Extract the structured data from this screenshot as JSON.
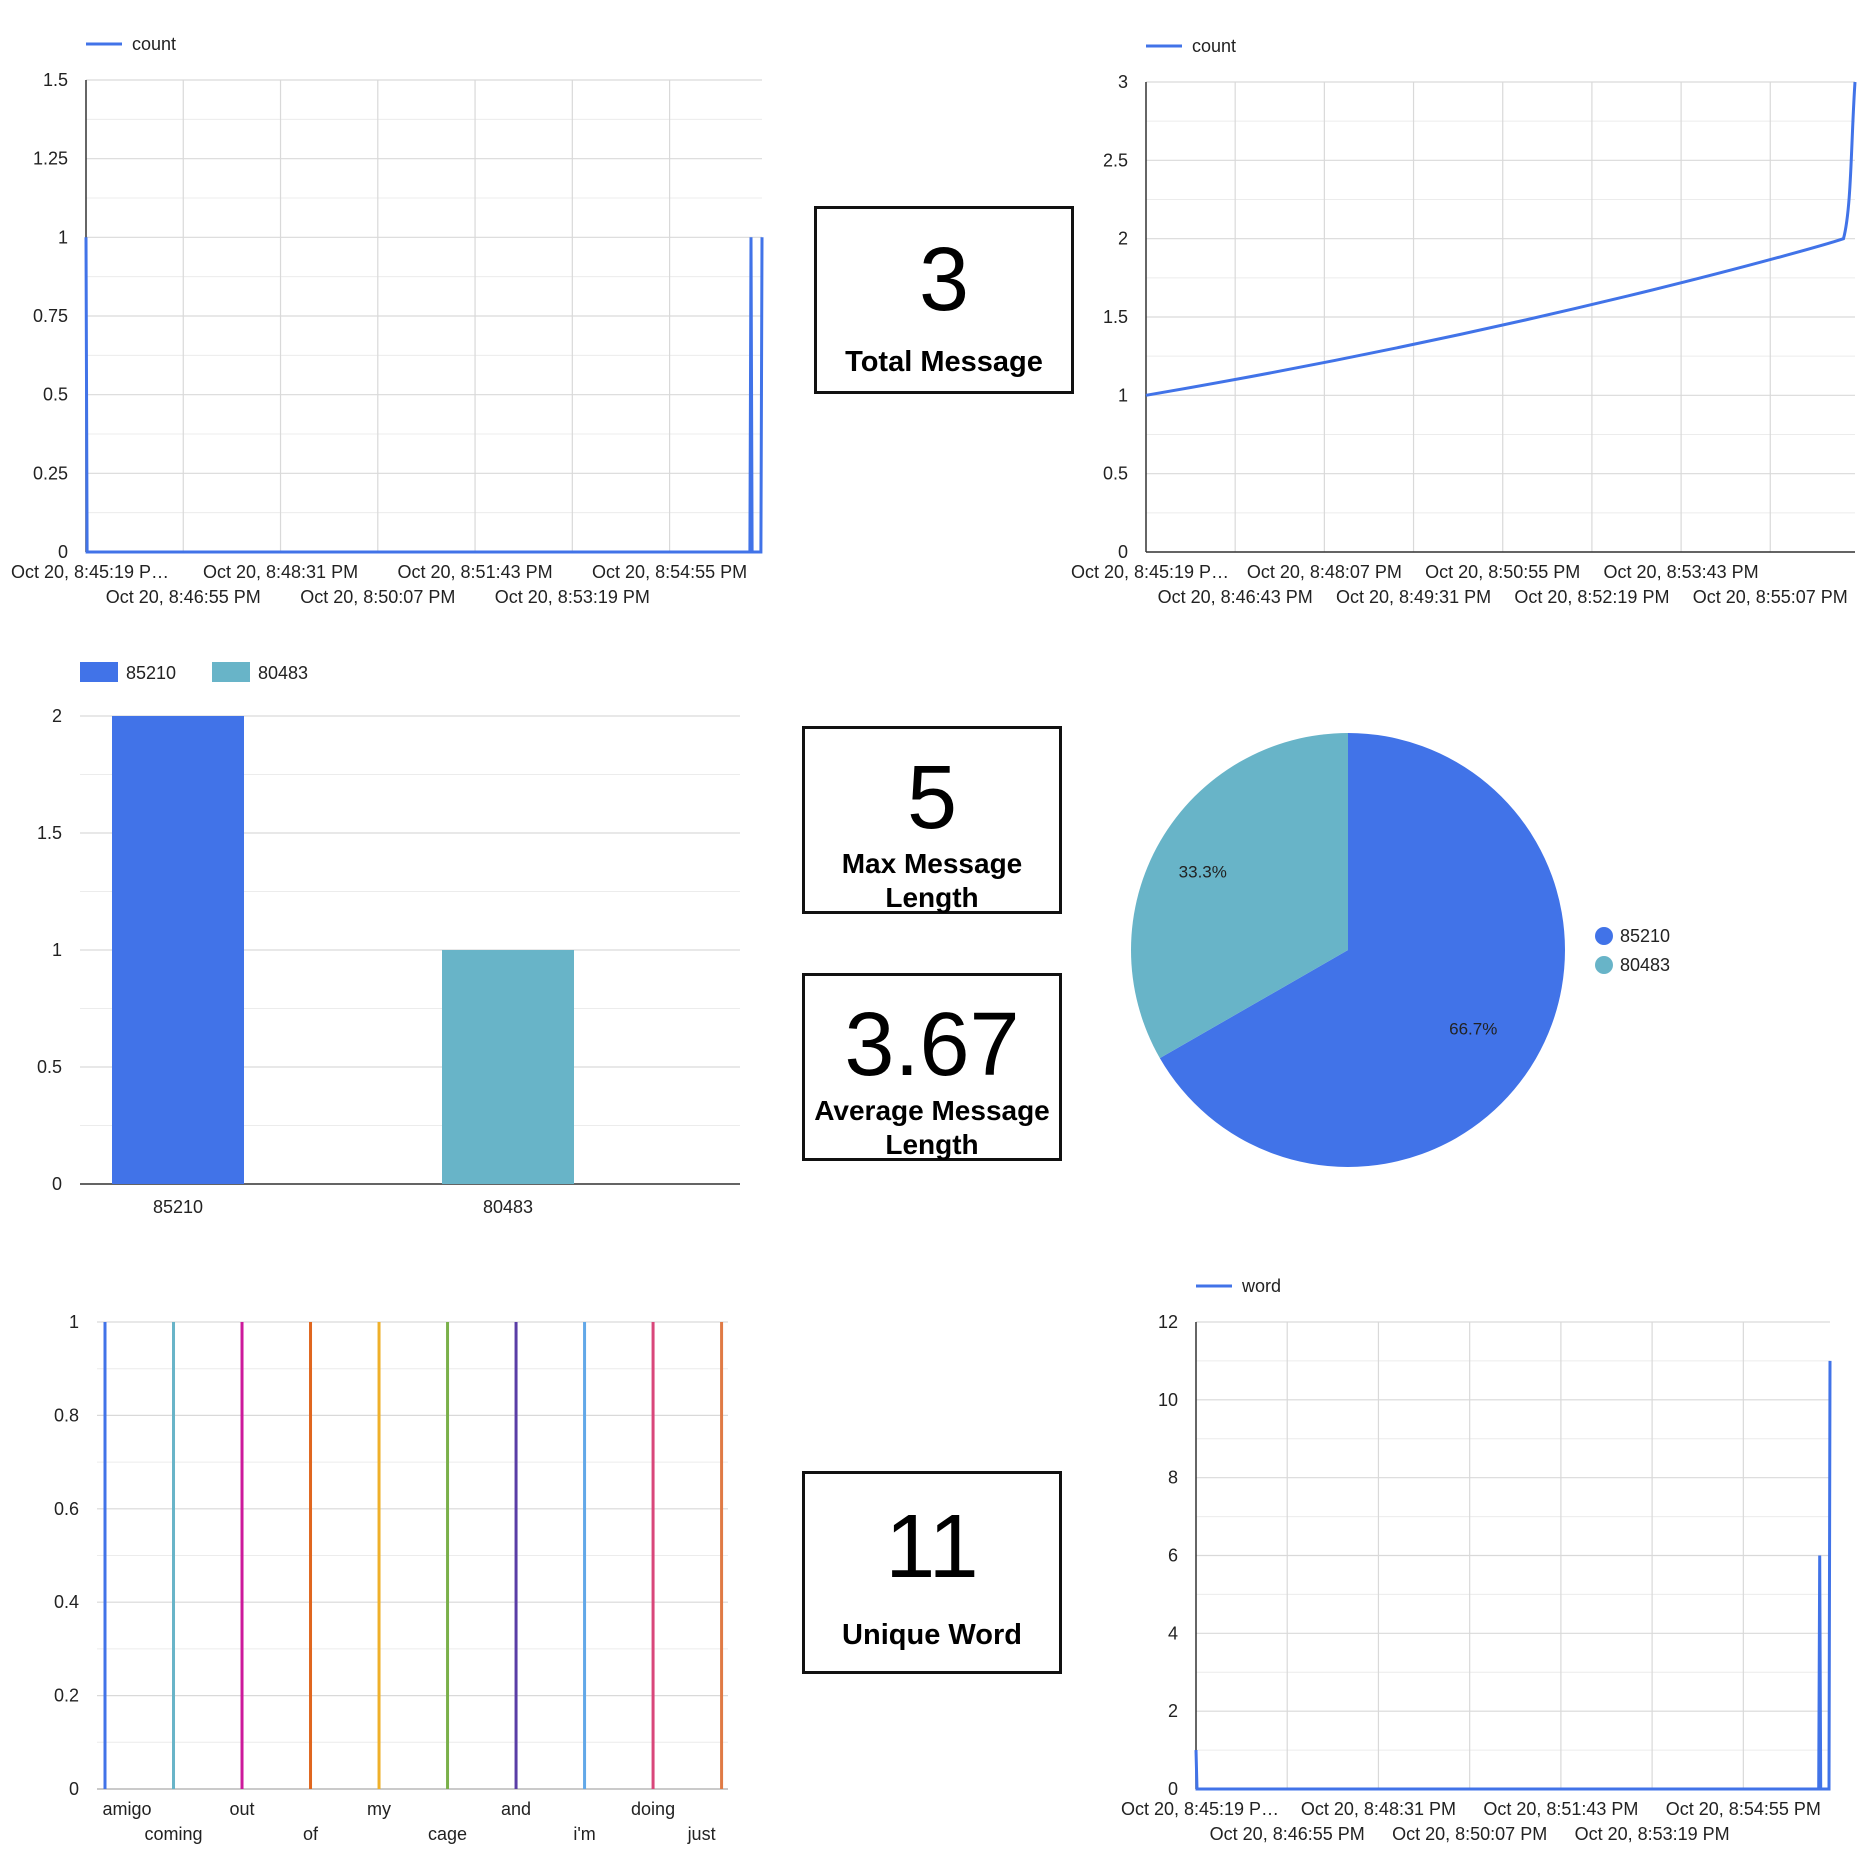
{
  "colors": {
    "blue": "#4173e8",
    "teal": "#68b4c8"
  },
  "charts": [
    {
      "id": "count_timeline",
      "type": "line",
      "legend": [
        "count"
      ],
      "x_ticks_top": [
        "Oct 20, 8:45:19 P…",
        "Oct 20, 8:48:31 PM",
        "Oct 20, 8:51:43 PM",
        "Oct 20, 8:54:55 PM"
      ],
      "x_ticks_bottom": [
        "Oct 20, 8:46:55 PM",
        "Oct 20, 8:50:07 PM",
        "Oct 20, 8:53:19 PM"
      ],
      "y_ticks": [
        "0",
        "0.25",
        "0.5",
        "0.75",
        "1",
        "1.25",
        "1.5"
      ],
      "ylim": [
        0,
        1.5
      ],
      "grid": true,
      "legend_position": "top-left",
      "series": [
        {
          "name": "count",
          "points": [
            [
              "8:45:19 PM",
              1
            ],
            [
              "8:45:20 PM",
              0
            ],
            [
              "8:55:24 PM",
              0
            ],
            [
              "8:55:25 PM",
              1
            ],
            [
              "8:55:26 PM",
              0
            ],
            [
              "8:55:34 PM",
              0
            ],
            [
              "8:55:35 PM",
              1
            ]
          ]
        }
      ]
    },
    {
      "id": "cumulative_count",
      "type": "line",
      "legend": [
        "count"
      ],
      "x_ticks_top": [
        "Oct 20, 8:45:19 P…",
        "Oct 20, 8:48:07 PM",
        "Oct 20, 8:50:55 PM",
        "Oct 20, 8:53:43 PM"
      ],
      "x_ticks_bottom": [
        "Oct 20, 8:46:43 PM",
        "Oct 20, 8:49:31 PM",
        "Oct 20, 8:52:19 PM",
        "Oct 20, 8:55:07 PM"
      ],
      "y_ticks": [
        "0",
        "0.5",
        "1",
        "1.5",
        "2",
        "2.5",
        "3"
      ],
      "ylim": [
        0,
        3
      ],
      "grid": true,
      "legend_position": "top-left",
      "series": [
        {
          "name": "count",
          "points": [
            [
              "8:45:19 PM",
              1
            ],
            [
              "8:55:25 PM",
              2
            ],
            [
              "8:55:35 PM",
              3
            ]
          ]
        }
      ]
    },
    {
      "id": "messages_by_user_bar",
      "type": "bar",
      "legend": [
        "85210",
        "80483"
      ],
      "categories": [
        "85210",
        "80483"
      ],
      "values": [
        2,
        1
      ],
      "y_ticks": [
        "0",
        "0.5",
        "1",
        "1.5",
        "2"
      ],
      "ylim": [
        0,
        2
      ],
      "grid": true,
      "legend_position": "top-left"
    },
    {
      "id": "messages_by_user_pie",
      "type": "pie",
      "legend": [
        "85210",
        "80483"
      ],
      "values": [
        66.7,
        33.3
      ],
      "labels": [
        "66.7%",
        "33.3%"
      ],
      "legend_position": "right"
    },
    {
      "id": "words_bar",
      "type": "bar",
      "categories": [
        "amigo",
        "coming",
        "out",
        "of",
        "my",
        "cage",
        "and",
        "i'm",
        "doing",
        "just"
      ],
      "values": [
        1,
        1,
        1,
        1,
        1,
        1,
        1,
        1,
        1,
        1
      ],
      "bar_colors": [
        "#4173e8",
        "#68b4c8",
        "#cc1a9b",
        "#e0661e",
        "#efb02a",
        "#7ab04a",
        "#5a3da6",
        "#62a8e8",
        "#d9477a",
        "#e07a45"
      ],
      "y_ticks": [
        "0",
        "0.2",
        "0.4",
        "0.6",
        "0.8",
        "1"
      ],
      "ylim": [
        0,
        1
      ],
      "grid": true
    },
    {
      "id": "word_timeline",
      "type": "line",
      "legend": [
        "word"
      ],
      "x_ticks_top": [
        "Oct 20, 8:45:19 P…",
        "Oct 20, 8:48:31 PM",
        "Oct 20, 8:51:43 PM",
        "Oct 20, 8:54:55 PM"
      ],
      "x_ticks_bottom": [
        "Oct 20, 8:46:55 PM",
        "Oct 20, 8:50:07 PM",
        "Oct 20, 8:53:19 PM"
      ],
      "y_ticks": [
        "0",
        "2",
        "4",
        "6",
        "8",
        "10",
        "12"
      ],
      "ylim": [
        0,
        12
      ],
      "grid": true,
      "legend_position": "top-left",
      "series": [
        {
          "name": "word",
          "points": [
            [
              "8:45:19 PM",
              1
            ],
            [
              "8:45:20 PM",
              0
            ],
            [
              "8:55:24 PM",
              0
            ],
            [
              "8:55:25 PM",
              6
            ],
            [
              "8:55:26 PM",
              0
            ],
            [
              "8:55:34 PM",
              0
            ],
            [
              "8:55:35 PM",
              11
            ]
          ]
        }
      ]
    }
  ],
  "scorecards": {
    "total_message": {
      "value": "3",
      "label": "Total Message"
    },
    "max_message_length": {
      "value": "5",
      "label_line1": "Max Message",
      "label_line2": "Length"
    },
    "average_message_length": {
      "value": "3.67",
      "label_line1": "Average Message",
      "label_line2": "Length"
    },
    "unique_word": {
      "value": "11",
      "label": "Unique Word"
    }
  }
}
